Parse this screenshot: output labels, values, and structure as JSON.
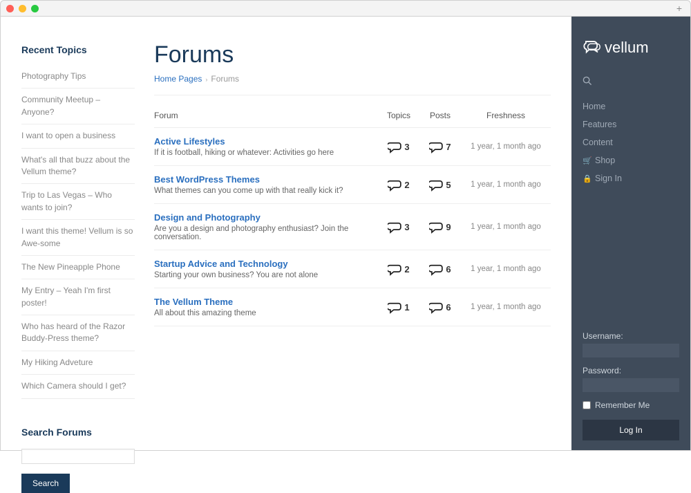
{
  "brand": {
    "name": "vellum"
  },
  "left_sidebar": {
    "recent_heading": "Recent Topics",
    "search_heading": "Search Forums",
    "search_button": "Search",
    "recent_topics": [
      {
        "label": "Photography Tips"
      },
      {
        "label": "Community Meetup – Anyone?"
      },
      {
        "label": "I want to open a business"
      },
      {
        "label": "What's all that buzz about the Vellum theme?"
      },
      {
        "label": "Trip to Las Vegas – Who wants to join?"
      },
      {
        "label": "I want this theme! Vellum is so Awe-some"
      },
      {
        "label": "The New Pineapple Phone"
      },
      {
        "label": "My Entry – Yeah I'm first poster!"
      },
      {
        "label": "Who has heard of the Razor Buddy-Press theme?"
      },
      {
        "label": "My Hiking Adveture"
      },
      {
        "label": "Which Camera should I get?"
      }
    ]
  },
  "page": {
    "title": "Forums",
    "breadcrumb": {
      "home": "Home Pages",
      "current": "Forums"
    },
    "table_head": {
      "forum": "Forum",
      "topics": "Topics",
      "posts": "Posts",
      "freshness": "Freshness"
    }
  },
  "forums": [
    {
      "name": "Active Lifestyles",
      "desc": "If it is football, hiking or whatever: Activities go here",
      "topics": "3",
      "posts": "7",
      "freshness": "1 year, 1 month ago"
    },
    {
      "name": "Best WordPress Themes",
      "desc": "What themes can you come up with that really kick it?",
      "topics": "2",
      "posts": "5",
      "freshness": "1 year, 1 month ago"
    },
    {
      "name": "Design and Photography",
      "desc": "Are you a design and photography enthusiast? Join the conversation.",
      "topics": "3",
      "posts": "9",
      "freshness": "1 year, 1 month ago"
    },
    {
      "name": "Startup Advice and Technology",
      "desc": "Starting your own business? You are not alone",
      "topics": "2",
      "posts": "6",
      "freshness": "1 year, 1 month ago"
    },
    {
      "name": "The Vellum Theme",
      "desc": "All about this amazing theme",
      "topics": "1",
      "posts": "6",
      "freshness": "1 year, 1 month ago"
    }
  ],
  "right_nav": {
    "items": [
      {
        "label": "Home"
      },
      {
        "label": "Features"
      },
      {
        "label": "Content"
      },
      {
        "label": "Shop",
        "icon": "cart"
      },
      {
        "label": "Sign In",
        "icon": "lock"
      }
    ]
  },
  "login": {
    "username_label": "Username:",
    "password_label": "Password:",
    "remember_label": "Remember Me",
    "button": "Log In"
  }
}
